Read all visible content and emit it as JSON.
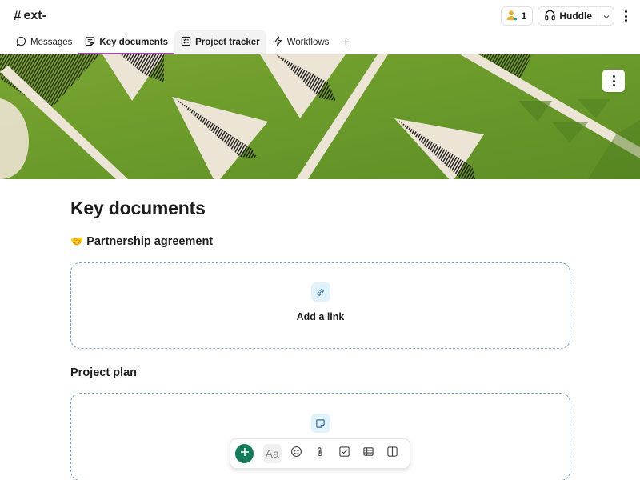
{
  "header": {
    "channel_prefix": "#",
    "channel_name": "ext-",
    "members_count": "1",
    "huddle_label": "Huddle",
    "icons": {
      "members": "person-icon",
      "huddle": "headphones-icon",
      "huddle_menu": "chevron-down-icon",
      "more": "kebab-icon"
    }
  },
  "tabs": [
    {
      "label": "Messages",
      "icon": "message-bubble-icon",
      "state": "normal"
    },
    {
      "label": "Key documents",
      "icon": "canvas-icon",
      "state": "active"
    },
    {
      "label": "Project tracker",
      "icon": "list-icon",
      "state": "hover"
    },
    {
      "label": "Workflows",
      "icon": "lightning-icon",
      "state": "normal"
    },
    {
      "label": "+",
      "icon": "plus-icon",
      "state": "add"
    }
  ],
  "banner": {
    "description": "Green banner with cream paper airplanes",
    "menu_icon": "kebab-icon",
    "colors": {
      "green": "#6b9a2c",
      "cream": "#ece4d4"
    }
  },
  "document": {
    "title": "Key documents",
    "sections": [
      {
        "heading": "Partnership agreement",
        "emoji": "🤝",
        "placeholder_label": "Add a link",
        "placeholder_icon": "link-icon"
      },
      {
        "heading": "Project plan",
        "emoji": "",
        "placeholder_label": "",
        "placeholder_icon": "canvas-note-icon"
      }
    ]
  },
  "toolbar": {
    "add_label": "+",
    "text_style_label": "Aa",
    "items": [
      "add-icon",
      "text-style-icon",
      "emoji-icon",
      "attachment-icon",
      "checklist-icon",
      "table-icon",
      "columns-icon"
    ]
  },
  "colors": {
    "accent_tab": "#9b4fa7",
    "add_button": "#147a5a",
    "dashed_border": "#7aa0bf",
    "icon_bg": "#e0f2fc"
  }
}
